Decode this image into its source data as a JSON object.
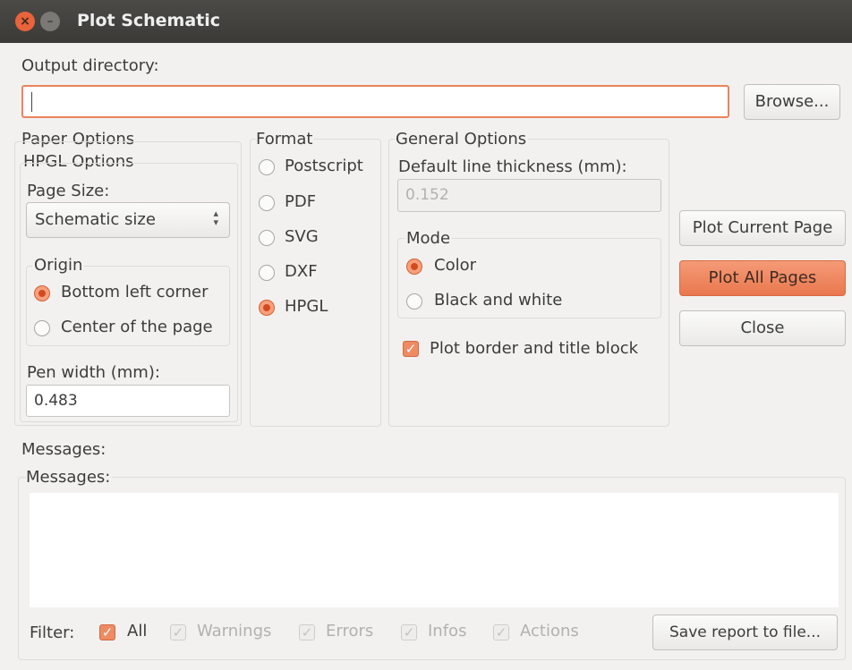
{
  "window": {
    "title": "Plot Schematic"
  },
  "output": {
    "label": "Output directory:",
    "value": "",
    "browse": "Browse..."
  },
  "paper": {
    "label": "Paper Options",
    "hpgl_label": "HPGL Options",
    "page_size_label": "Page Size:",
    "page_size_value": "Schematic size",
    "origin_label": "Origin",
    "origin_options": [
      "Bottom left corner",
      "Center of the page"
    ],
    "origin_selected": "Bottom left corner",
    "pen_width_label": "Pen width (mm):",
    "pen_width_value": "0.483"
  },
  "format": {
    "label": "Format",
    "options": [
      "Postscript",
      "PDF",
      "SVG",
      "DXF",
      "HPGL"
    ],
    "selected": "HPGL"
  },
  "general": {
    "label": "General Options",
    "line_thickness_label": "Default line thickness (mm):",
    "line_thickness_value": "0.152",
    "mode_label": "Mode",
    "mode_options": [
      "Color",
      "Black and white"
    ],
    "mode_selected": "Color",
    "plot_border_label": "Plot border and title block",
    "plot_border_checked": true
  },
  "actions": {
    "plot_current": "Plot Current Page",
    "plot_all": "Plot All Pages",
    "close": "Close"
  },
  "messages": {
    "label": "Messages:",
    "group_label": "Messages:",
    "filter_label": "Filter:",
    "filters": [
      {
        "label": "All",
        "checked": true,
        "enabled": true
      },
      {
        "label": "Warnings",
        "checked": true,
        "enabled": false
      },
      {
        "label": "Errors",
        "checked": true,
        "enabled": false
      },
      {
        "label": "Infos",
        "checked": true,
        "enabled": false
      },
      {
        "label": "Actions",
        "checked": true,
        "enabled": false
      }
    ],
    "save_report": "Save report to file..."
  },
  "colors": {
    "accent": "#e9784e",
    "titlebar": "#3b3a37",
    "background": "#f2f1f0"
  }
}
